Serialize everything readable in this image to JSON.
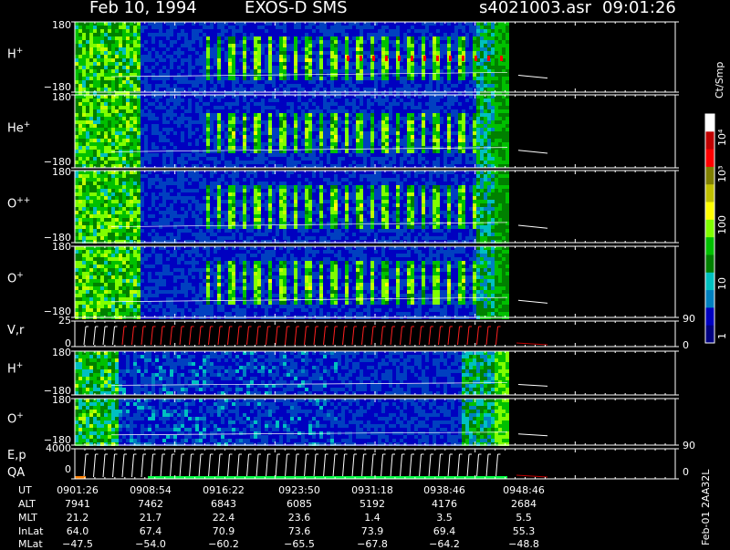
{
  "header": {
    "date": "Feb 10, 1994",
    "instrument": "EXOS-D SMS",
    "file": "s4021003.asr",
    "time": "09:01:26"
  },
  "panels": [
    {
      "label": "H",
      "sup": "+",
      "top": "180",
      "bottom": "−180"
    },
    {
      "label": "He",
      "sup": "+",
      "top": "180",
      "bottom": "−180"
    },
    {
      "label": "O",
      "sup": "++",
      "top": "180",
      "bottom": "−180"
    },
    {
      "label": "O",
      "sup": "+",
      "top": "180",
      "bottom": "−180"
    },
    {
      "label": "V,r",
      "sup": "",
      "top": "25",
      "bottom": "0",
      "right_top": "90",
      "right_bottom": "0"
    },
    {
      "label": "H",
      "sup": "+",
      "top": "180",
      "bottom": "−180"
    },
    {
      "label": "O",
      "sup": "+",
      "top": "180",
      "bottom": "−180"
    },
    {
      "label": "E,p",
      "label2": "QA",
      "sup": "",
      "top": "4000",
      "bottom": "0",
      "right_top": "90",
      "right_bottom": "0"
    }
  ],
  "colorbar": {
    "unit": "Ct/Smp",
    "ticks": [
      "10⁴",
      "10³",
      "100",
      "10",
      "1"
    ],
    "colors": [
      "#ffffff",
      "#c00000",
      "#ff0000",
      "#808000",
      "#c0c000",
      "#ffff00",
      "#80ff00",
      "#00c000",
      "#008000",
      "#00c0c0",
      "#0080c0",
      "#0000c0",
      "#000080"
    ]
  },
  "footer": {
    "row_labels": [
      "UT",
      "ALT",
      "MLT",
      "InLat",
      "MLat"
    ],
    "columns": [
      [
        "0901:26",
        "7941",
        "21.2",
        "64.0",
        "−47.5"
      ],
      [
        "0908:54",
        "7462",
        "21.7",
        "67.4",
        "−54.0"
      ],
      [
        "0916:22",
        "6843",
        "22.4",
        "70.9",
        "−60.2"
      ],
      [
        "0923:50",
        "6085",
        "23.6",
        "73.6",
        "−65.5"
      ],
      [
        "0931:18",
        "5192",
        "1.4",
        "73.9",
        "−67.8"
      ],
      [
        "0938:46",
        "4176",
        "3.5",
        "69.4",
        "−64.2"
      ],
      [
        "0948:46",
        "2684",
        "5.5",
        "55.3",
        "−48.8"
      ]
    ],
    "stamp": "Feb-01  2AA32L"
  },
  "chart_data": {
    "type": "heatmap",
    "title": "Feb 10, 1994   EXOS-D SMS",
    "x_ticks": [
      "0901:26",
      "0908:54",
      "0916:22",
      "0923:50",
      "0931:18",
      "0938:46",
      "0948:46"
    ],
    "series": [
      {
        "name": "H+",
        "ylim": [
          -180,
          180
        ]
      },
      {
        "name": "He+",
        "ylim": [
          -180,
          180
        ]
      },
      {
        "name": "O++",
        "ylim": [
          -180,
          180
        ]
      },
      {
        "name": "O+",
        "ylim": [
          -180,
          180
        ]
      },
      {
        "name": "V,r",
        "ylim": [
          0,
          25
        ]
      },
      {
        "name": "H+",
        "ylim": [
          -180,
          180
        ]
      },
      {
        "name": "O+",
        "ylim": [
          -180,
          180
        ]
      },
      {
        "name": "E,p / QA",
        "ylim": [
          0,
          4000
        ]
      }
    ],
    "colorbar_unit": "Ct/Smp",
    "colorbar_ticks": [
      "1",
      "10",
      "100",
      "10³",
      "10⁴"
    ]
  }
}
